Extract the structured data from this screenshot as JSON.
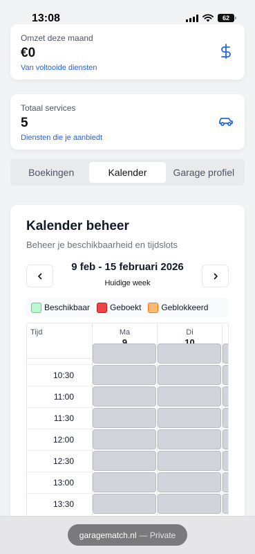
{
  "status": {
    "time": "13:08",
    "battery": "62"
  },
  "stats": [
    {
      "label": "Omzet deze maand",
      "value": "€0",
      "sub": "Van voltooide diensten",
      "icon": "dollar-icon"
    },
    {
      "label": "Totaal services",
      "value": "5",
      "sub": "Diensten die je aanbiedt",
      "icon": "car-icon"
    }
  ],
  "tabs": [
    {
      "label": "Boekingen",
      "active": false
    },
    {
      "label": "Kalender",
      "active": true
    },
    {
      "label": "Garage profiel",
      "active": false
    }
  ],
  "calendar": {
    "title": "Kalender beheer",
    "subtitle": "Beheer je beschikbaarheid en tijdslots",
    "week_range": "9 feb - 15 februari 2026",
    "week_label": "Huidige week",
    "legend": [
      {
        "label": "Beschikbaar",
        "color": "#bbf7d0",
        "border": "#4ade80"
      },
      {
        "label": "Geboekt",
        "color": "#ef4444",
        "border": "#b91c1c"
      },
      {
        "label": "Geblokkeerd",
        "color": "#fdba74",
        "border": "#f97316"
      }
    ],
    "time_header": "Tijd",
    "days": [
      {
        "name": "Ma",
        "num": "9"
      },
      {
        "name": "Di",
        "num": "10"
      }
    ],
    "times": [
      "10:30",
      "11:00",
      "11:30",
      "12:00",
      "12:30",
      "13:00",
      "13:30"
    ]
  },
  "browser": {
    "domain": "garagematch.nl",
    "privacy": "— Private"
  },
  "colors": {
    "link": "#2563eb",
    "slot_blocked": "#d1d5db"
  }
}
